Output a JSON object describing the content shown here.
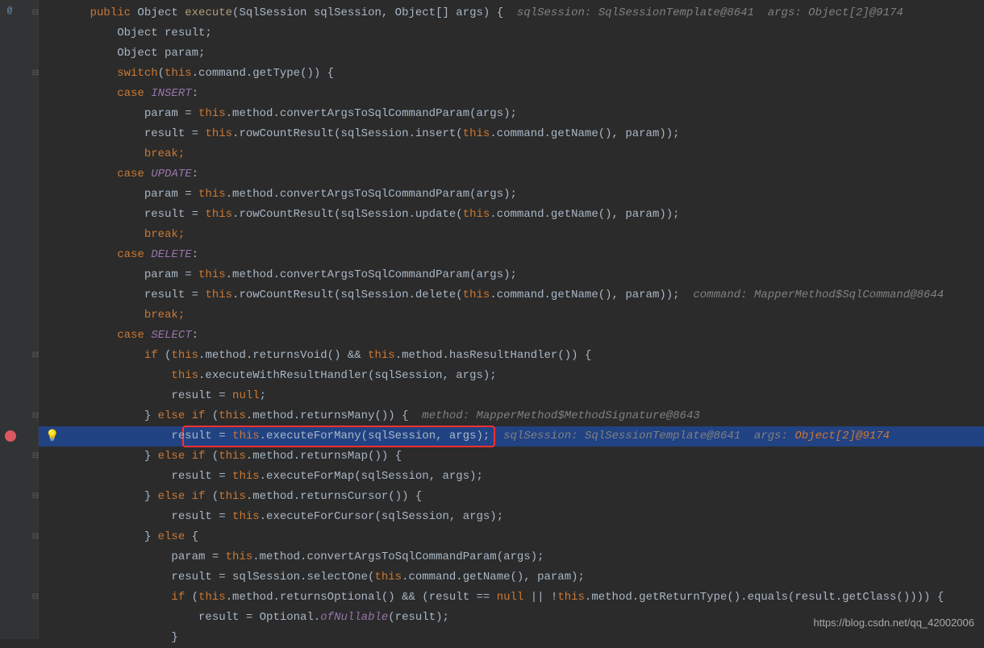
{
  "lines": {
    "l1_sig": "    public Object execute(SqlSession sqlSession, Object[] args) {  ",
    "l1_hint": "sqlSession: SqlSessionTemplate@8641  args: Object[2]@9174",
    "l2": "        Object result;",
    "l3": "        Object param;",
    "l4": "        switch(this.command.getType()) {",
    "l5": "        case INSERT:",
    "l6": "            param = this.method.convertArgsToSqlCommandParam(args);",
    "l7": "            result = this.rowCountResult(sqlSession.insert(this.command.getName(), param));",
    "l8": "            break;",
    "l9": "        case UPDATE:",
    "l10": "            param = this.method.convertArgsToSqlCommandParam(args);",
    "l11": "            result = this.rowCountResult(sqlSession.update(this.command.getName(), param));",
    "l12": "            break;",
    "l13": "        case DELETE:",
    "l14": "            param = this.method.convertArgsToSqlCommandParam(args);",
    "l15": "            result = this.rowCountResult(sqlSession.delete(this.command.getName(), param));  ",
    "l15_hint": "command: MapperMethod$SqlCommand@8644",
    "l16": "            break;",
    "l17": "        case SELECT:",
    "l18": "            if (this.method.returnsVoid() && this.method.hasResultHandler()) {",
    "l19": "                this.executeWithResultHandler(sqlSession, args);",
    "l20": "                result = null;",
    "l21": "            } else if (this.method.returnsMany()) {  ",
    "l21_hint": "method: MapperMethod$MethodSignature@8643",
    "l22": "                result = this.executeForMany(sqlSession, args);  ",
    "l22_hint1": "sqlSession: SqlSessionTemplate@8641  args: ",
    "l22_hint2": "Object[2]@9174",
    "l23": "            } else if (this.method.returnsMap()) {",
    "l24": "                result = this.executeForMap(sqlSession, args);",
    "l25": "            } else if (this.method.returnsCursor()) {",
    "l26": "                result = this.executeForCursor(sqlSession, args);",
    "l27": "            } else {",
    "l28": "                param = this.method.convertArgsToSqlCommandParam(args);",
    "l29": "                result = sqlSession.selectOne(this.command.getName(), param);",
    "l30": "                if (this.method.returnsOptional() && (result == null || !this.method.getReturnType().equals(result.getClass()))) {",
    "l31": "                    result = Optional.ofNullable(result);",
    "l32": "                }"
  },
  "watermark": "https://blog.csdn.net/qq_42002006"
}
